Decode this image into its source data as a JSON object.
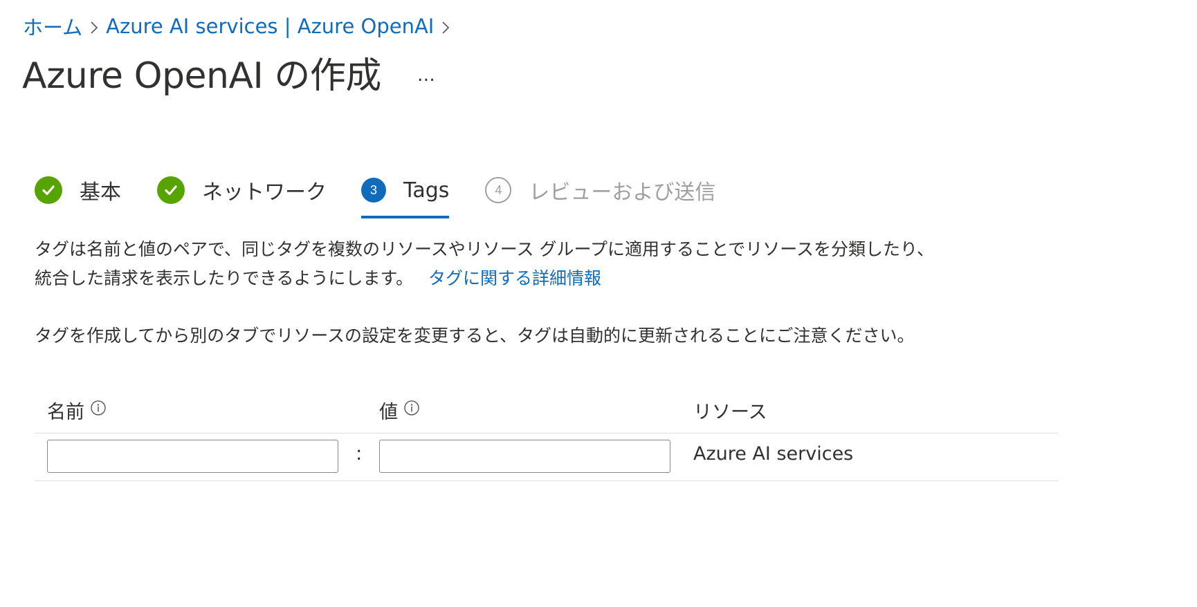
{
  "breadcrumb": {
    "items": [
      "ホーム",
      "Azure AI services | Azure OpenAI"
    ]
  },
  "header": {
    "title": "Azure OpenAI の作成",
    "more": "…"
  },
  "wizard": {
    "steps": [
      {
        "label": "基本",
        "state": "done"
      },
      {
        "label": "ネットワーク",
        "state": "done"
      },
      {
        "label": "Tags",
        "state": "current",
        "number": "3"
      },
      {
        "label": "レビューおよび送信",
        "state": "future",
        "number": "4"
      }
    ]
  },
  "description": {
    "line1": "タグは名前と値のペアで、同じタグを複数のリソースやリソース グループに適用することでリソースを分類したり、",
    "line2": "統合した請求を表示したりできるようにします。",
    "link": "タグに関する詳細情報",
    "note": "タグを作成してから別のタブでリソースの設定を変更すると、タグは自動的に更新されることにご注意ください。"
  },
  "tag_table": {
    "headers": {
      "name": "名前",
      "value": "値",
      "resource": "リソース"
    },
    "rows": [
      {
        "name": "",
        "separator": ":",
        "value": "",
        "resource": "Azure AI services"
      }
    ]
  },
  "colors": {
    "accent": "#0f6cbd",
    "success": "#57a300",
    "muted": "#a19f9d"
  }
}
